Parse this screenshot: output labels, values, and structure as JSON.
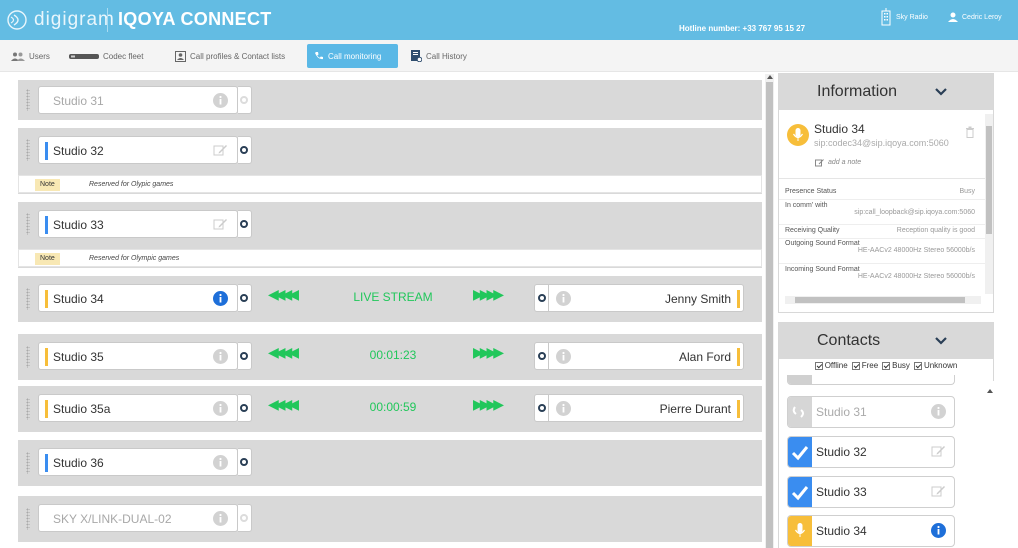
{
  "header": {
    "brand": "digigram",
    "product": "IQOYA CONNECT",
    "hotline": "Hotline number: +33 767 95 15 27",
    "org": "Sky Radio",
    "user": "Cedric Leroy"
  },
  "nav": {
    "users": "Users",
    "codec_fleet": "Codec fleet",
    "call_profiles": "Call profiles & Contact lists",
    "call_monitoring": "Call monitoring",
    "call_history": "Call History"
  },
  "rows": [
    {
      "name": "Studio 31"
    },
    {
      "name": "Studio 32",
      "note_label": "Note",
      "note": "Reserved for Olypic games"
    },
    {
      "name": "Studio 33",
      "note_label": "Note",
      "note": "Reserved for Olympic games"
    },
    {
      "name": "Studio 34",
      "status": "LIVE STREAM",
      "remote": "Jenny Smith"
    },
    {
      "name": "Studio 35",
      "status": "00:01:23",
      "remote": "Alan Ford"
    },
    {
      "name": "Studio 35a",
      "status": "00:00:59",
      "remote": "Pierre Durant"
    },
    {
      "name": "Studio 36"
    },
    {
      "name": "SKY X/LINK-DUAL-02"
    }
  ],
  "arrows": {
    "left": "◀◀◀◀",
    "right": "▶▶▶▶"
  },
  "information": {
    "title": "Information",
    "device": "Studio 34",
    "sip": "sip:codec34@sip.iqoya.com:5060",
    "add_note": "add a note",
    "presence_label": "Presence Status",
    "presence_value": "Busy",
    "incomm_label": "In comm' with",
    "incomm_value": "sip:call_loopback@sip.iqoya.com:5060",
    "quality_label": "Receiving Quality",
    "quality_value": "Reception quality is good",
    "out_label": "Outgoing Sound Format",
    "out_value": "HE-AACv2 48000Hz Stereo 56000b/s",
    "in_label": "Incoming Sound Format",
    "in_value": "HE-AACv2 48000Hz Stereo 56000b/s"
  },
  "contacts": {
    "title": "Contacts",
    "filters": [
      "Offline",
      "Free",
      "Busy",
      "Unknown"
    ],
    "items": [
      {
        "name": "Studio 31"
      },
      {
        "name": "Studio 32"
      },
      {
        "name": "Studio 33"
      },
      {
        "name": "Studio 34"
      }
    ]
  },
  "colors": {
    "header": "#63bce3",
    "active_tab": "#5ab8e6",
    "live_green": "#21c75b",
    "free_blue": "#3a8df0",
    "busy_yellow": "#f7be3a",
    "info_blue": "#1e6fd9"
  }
}
